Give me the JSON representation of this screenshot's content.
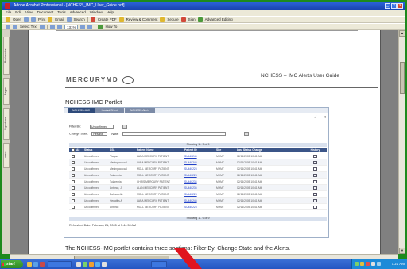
{
  "window": {
    "title": "Adobe Acrobat Professional - [NCHESS_IMC_User_Guide.pdf]",
    "controls": [
      "_",
      "□",
      "×"
    ]
  },
  "menu": [
    "File",
    "Edit",
    "View",
    "Document",
    "Tools",
    "Advanced",
    "Window",
    "Help"
  ],
  "toolbar1": {
    "open": "Open",
    "print": "Print",
    "email": "Email",
    "search": "Search",
    "create_pdf": "Create PDF",
    "review": "Review & Comment",
    "secure": "Secure",
    "sign": "Sign",
    "advanced_editing": "Advanced Editing"
  },
  "toolbar2": {
    "select_text": "Select Text",
    "zoom": "131%",
    "view": "How To"
  },
  "left_rail": [
    "Bookmarks",
    "Pages",
    "Signatures",
    "Layers"
  ],
  "doc": {
    "logo": "MERCURYMD",
    "header_title": "NCHESS – IMC Alerts User Guide",
    "portlet_heading": "NCHESS-IMC Portlet",
    "caption": "The NCHESS-IMC portlet contains three sections: Filter By, Change State and the Alerts."
  },
  "portlet": {
    "tabs": [
      "NCHESS-IMC",
      "Kushal Sheet",
      "NCHESS Alerts"
    ],
    "controls": "∕ – □",
    "filter_label": "Filter By:",
    "filter_value": "Unconfirmed",
    "change_state_label": "Change State:",
    "change_state_value": "Resolve",
    "note_label": "Note:",
    "showing": "Showing 1 - 9 of 9",
    "headers": [
      "",
      "All",
      "Status",
      "SSL",
      "Patient Name",
      "Patient ID",
      "Site",
      "Last Status Change",
      "History"
    ],
    "rows": [
      {
        "status": "Unconfirmed",
        "ssl": "Plague",
        "name": "LARA MERCURY PATIENT",
        "id": "SU440245",
        "site": "MHMT",
        "changed": "02/16/2005 10:41 AM"
      },
      {
        "status": "Unconfirmed",
        "ssl": "Meningococcal",
        "name": "LARA MERCURY PATIENT",
        "id": "SU440245",
        "site": "MHMT",
        "changed": "02/16/2005 10:41 AM"
      },
      {
        "status": "Unconfirmed",
        "ssl": "Meningococcal",
        "name": "MOLL MERCURY PATIENT",
        "id": "SU440223",
        "site": "MHMT",
        "changed": "02/16/2005 10:41 AM"
      },
      {
        "status": "Unconfirmed",
        "ssl": "Tularemia",
        "name": "MOLL MERCURY PATIENT",
        "id": "SU440223",
        "site": "MHMT",
        "changed": "02/16/2005 10:41 AM"
      },
      {
        "status": "Unconfirmed",
        "ssl": "Tularemia",
        "name": "CHRIS MERCURY PATIENT",
        "id": "SU440234",
        "site": "MHMT",
        "changed": "02/16/2005 10:41 AM"
      },
      {
        "status": "Unconfirmed",
        "ssl": "Anthrax, J.",
        "name": "ALAN MERCURY PATIENT",
        "id": "SU440236",
        "site": "MHMT",
        "changed": "02/16/2005 10:41 AM"
      },
      {
        "status": "Unconfirmed",
        "ssl": "Salmonella",
        "name": "MOLL MERCURY PATIENT",
        "id": "SU440223",
        "site": "MHMT",
        "changed": "02/16/2005 10:41 AM"
      },
      {
        "status": "Unconfirmed",
        "ssl": "Hepatitis A",
        "name": "LARA MERCURY PATIENT",
        "id": "SU440245",
        "site": "MHMT",
        "changed": "02/16/2005 10:41 AM"
      },
      {
        "status": "Unconfirmed",
        "ssl": "Anthrax",
        "name": "MOLL MERCURY PATIENT",
        "id": "SU440223",
        "site": "MHMT",
        "changed": "02/16/2005 10:41 AM"
      }
    ],
    "refreshed": "Refreshed Date: February 21, 2005 at 5:44:50 AM"
  },
  "taskbar": {
    "start": "start",
    "clock": "7:21 AM"
  },
  "colors": {
    "frame": "#1d8a1d",
    "header_blue": "#3b5588",
    "arrow": "#e0141e"
  }
}
